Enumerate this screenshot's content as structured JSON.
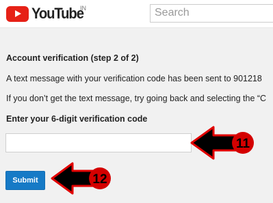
{
  "header": {
    "logo_text": "YouTube",
    "country_code": "IN",
    "search_placeholder": "Search"
  },
  "verification": {
    "heading": "Account verification (step 2 of 2)",
    "sent_message": "A text message with your verification code has been sent to 901218",
    "retry_message": "If you don’t get the text message, try going back and selecting the “C",
    "code_label": "Enter your 6-digit verification code",
    "code_value": "",
    "submit_label": "Submit"
  },
  "annotations": [
    {
      "number": "11",
      "target": "code-input"
    },
    {
      "number": "12",
      "target": "submit-button"
    }
  ],
  "colors": {
    "brand_red": "#e62117",
    "button_blue": "#167ac6",
    "annotation_red": "#e10000"
  }
}
